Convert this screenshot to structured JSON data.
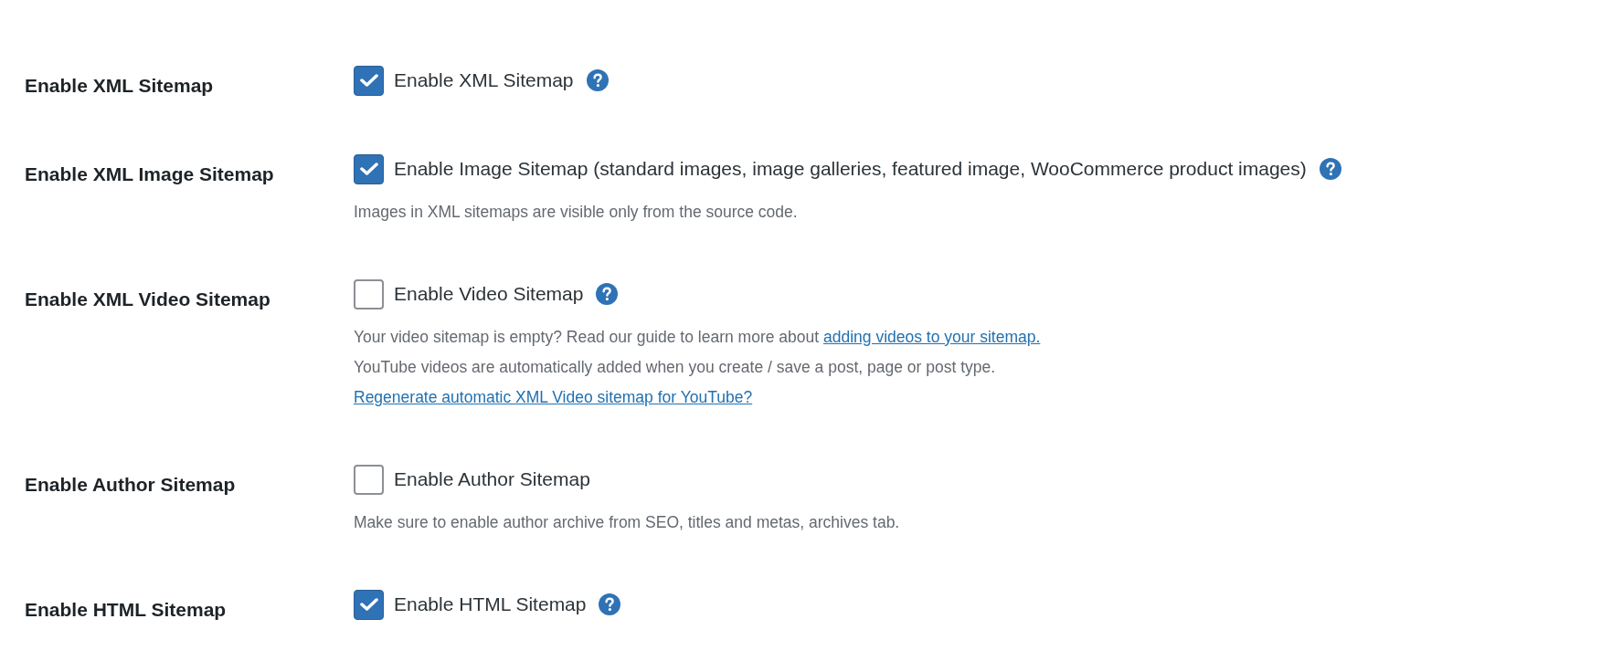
{
  "settings": [
    {
      "label": "Enable XML Sitemap",
      "checked": true,
      "option": "Enable XML Sitemap",
      "help": true
    },
    {
      "label": "Enable XML Image Sitemap",
      "checked": true,
      "option": "Enable Image Sitemap (standard images, image galleries, featured image, WooCommerce product images)",
      "help": true,
      "notes": [
        {
          "text": "Images in XML sitemaps are visible only from the source code."
        }
      ]
    },
    {
      "label": "Enable XML Video Sitemap",
      "checked": false,
      "option": "Enable Video Sitemap",
      "help": true,
      "notes": [
        {
          "text": "Your video sitemap is empty? Read our guide to learn more about",
          "link": "adding videos to your sitemap."
        },
        {
          "text": "YouTube videos are automatically added when you create / save a post, page or post type."
        },
        {
          "link": "Regenerate automatic XML Video sitemap for YouTube?"
        }
      ]
    },
    {
      "label": "Enable Author Sitemap",
      "checked": false,
      "option": "Enable Author Sitemap",
      "help": false,
      "notes": [
        {
          "text": "Make sure to enable author archive from SEO, titles and metas, archives tab."
        }
      ]
    },
    {
      "label": "Enable HTML Sitemap",
      "checked": true,
      "option": "Enable HTML Sitemap",
      "help": true
    }
  ]
}
